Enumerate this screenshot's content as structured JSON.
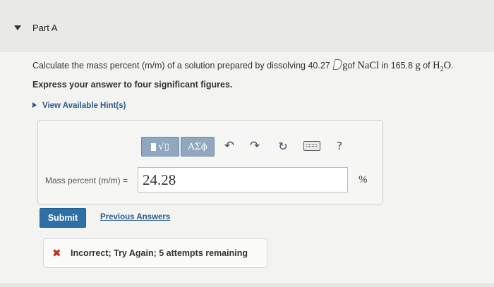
{
  "part": {
    "title": "Part A",
    "caret_icon": "triangle-down-icon"
  },
  "question": {
    "text_before": "Calculate the mass percent (m/m) of a solution prepared by dissolving 40.27",
    "mass_unit": "g",
    "of_word": "of",
    "solute": "NaCl",
    "text_middle": "in 165.8",
    "solvent_mass_unit": "g",
    "of_word_2": "of",
    "solvent_h": "H",
    "solvent_sub": "2",
    "solvent_o": "O",
    "period": "."
  },
  "instruction": "Express your answer to four significant figures.",
  "hint": {
    "label": "View Available Hint(s)",
    "icon": "triangle-right-icon"
  },
  "toolbar": {
    "matrix_label": "√▯",
    "greek_label": "ΑΣϕ",
    "undo_icon": "↶",
    "redo_icon": "↷",
    "reset_icon": "↻",
    "help_label": "?"
  },
  "answer": {
    "label": "Mass percent (m/m) =",
    "value": "24.28",
    "unit": "%"
  },
  "actions": {
    "submit_label": "Submit",
    "previous_answers_label": "Previous Answers"
  },
  "feedback": {
    "icon": "✖",
    "text": "Incorrect; Try Again; 5 attempts remaining",
    "color": "#c32a1f"
  },
  "colors": {
    "accent": "#2f6fa6",
    "link": "#2b5c8a",
    "toolbar_button": "#8fa8bf"
  }
}
